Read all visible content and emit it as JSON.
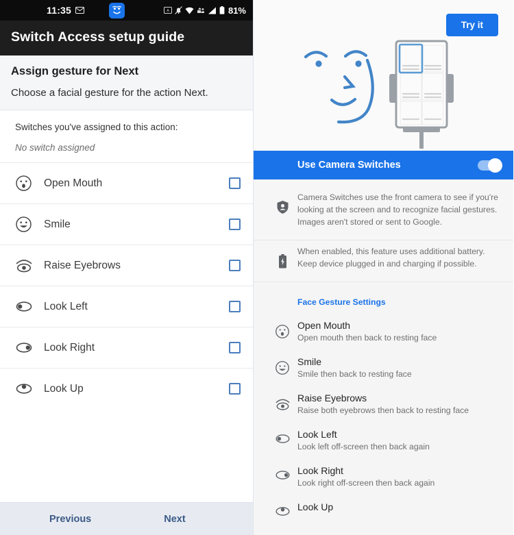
{
  "left": {
    "statusbar": {
      "time": "11:35",
      "mail_icon": "mail-icon",
      "face_chip_icon": "camera-switches-face-icon",
      "icons": [
        "screenshot-icon",
        "notifications-muted-icon",
        "wifi-icon",
        "vpn-icon",
        "signal-icon",
        "battery-icon"
      ],
      "battery_percent": "81%"
    },
    "appbar": {
      "title": "Switch Access setup guide"
    },
    "section": {
      "title": "Assign gesture for Next",
      "subtitle": "Choose a facial gesture for the action Next."
    },
    "assigned": {
      "label": "Switches you've assigned to this action:",
      "value": "No switch assigned"
    },
    "gestures": [
      {
        "icon": "open-mouth-icon",
        "label": "Open Mouth",
        "checked": false
      },
      {
        "icon": "smile-icon",
        "label": "Smile",
        "checked": false
      },
      {
        "icon": "raise-eyebrows-icon",
        "label": "Raise Eyebrows",
        "checked": false
      },
      {
        "icon": "look-left-icon",
        "label": "Look Left",
        "checked": false
      },
      {
        "icon": "look-right-icon",
        "label": "Look Right",
        "checked": false
      },
      {
        "icon": "look-up-icon",
        "label": "Look Up",
        "checked": false
      }
    ],
    "bottom": {
      "previous": "Previous",
      "next": "Next"
    }
  },
  "right": {
    "try_it": "Try it",
    "hero": {
      "art": "face-and-phone-illustration"
    },
    "toggle": {
      "label": "Use Camera Switches",
      "on": true
    },
    "info": [
      {
        "icon": "privacy-shield-icon",
        "text": "Camera Switches use the front camera to see if you're looking at the screen and to recognize facial gestures. Images aren't stored or sent to Google."
      },
      {
        "icon": "battery-charging-icon",
        "text": "When enabled, this feature uses additional battery. Keep device plugged in and charging if possible."
      }
    ],
    "face_gesture_settings_header": "Face Gesture Settings",
    "gestures": [
      {
        "icon": "open-mouth-icon",
        "title": "Open Mouth",
        "sub": "Open mouth then back to resting face"
      },
      {
        "icon": "smile-icon",
        "title": "Smile",
        "sub": "Smile then back to resting face"
      },
      {
        "icon": "raise-eyebrows-icon",
        "title": "Raise Eyebrows",
        "sub": "Raise both eyebrows then back to resting face"
      },
      {
        "icon": "look-left-icon",
        "title": "Look Left",
        "sub": "Look left off-screen then back again"
      },
      {
        "icon": "look-right-icon",
        "title": "Look Right",
        "sub": "Look right off-screen then back again"
      },
      {
        "icon": "look-up-icon",
        "title": "Look Up",
        "sub": ""
      }
    ]
  },
  "colors": {
    "accent_blue": "#1a73e8",
    "statusbar_bg": "#0c0c0c",
    "appbar_bg": "#1e1e1e",
    "checkbox_border": "#4b7ebd",
    "nav_link": "#3c5a87"
  }
}
